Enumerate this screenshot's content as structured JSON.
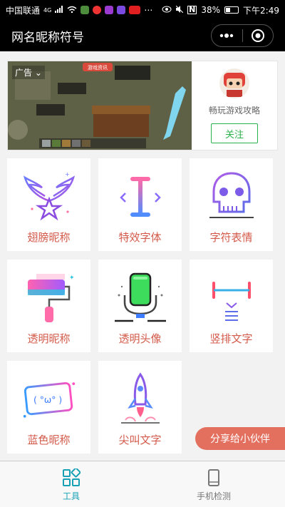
{
  "status_bar": {
    "carrier": "中国联通",
    "network": "4G",
    "battery": "38%",
    "time": "下午2:49"
  },
  "header": {
    "title": "网名昵称符号"
  },
  "ad": {
    "tag": "广告",
    "account_name": "畅玩游戏攻略",
    "follow_label": "关注",
    "image_text": "游戏资讯"
  },
  "tools": [
    {
      "label": "翅膀昵称",
      "icon": "wings-star-icon"
    },
    {
      "label": "特效字体",
      "icon": "text-cursor-icon"
    },
    {
      "label": "字符表情",
      "icon": "skull-icon"
    },
    {
      "label": "透明昵称",
      "icon": "paint-roller-icon"
    },
    {
      "label": "透明头像",
      "icon": "microphone-icon"
    },
    {
      "label": "竖排文字",
      "icon": "vertical-text-icon"
    },
    {
      "label": "蓝色昵称",
      "icon": "emoticon-card-icon"
    },
    {
      "label": "尖叫文字",
      "icon": "rocket-icon"
    }
  ],
  "emoticon_text": "( °ω° )",
  "share_label": "分享给小伙伴",
  "tabbar": {
    "items": [
      {
        "label": "工具",
        "active": true,
        "color": "#18a1b4"
      },
      {
        "label": "手机检测",
        "active": false,
        "color": "#777777"
      }
    ]
  }
}
